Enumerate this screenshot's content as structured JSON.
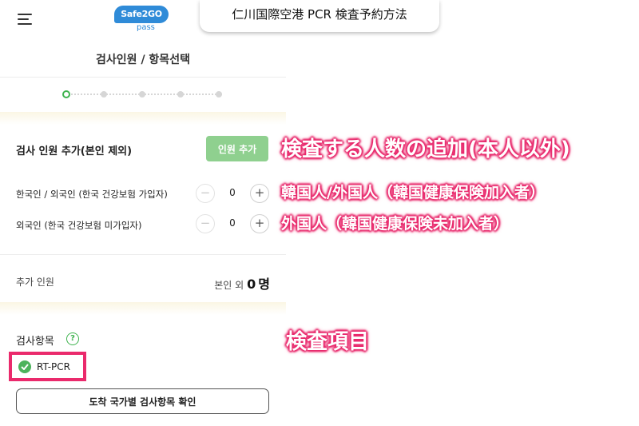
{
  "header": {
    "logo_text": "Safe2GO",
    "logo_sub": "pass",
    "page_title": "검사인원 / 항목선택"
  },
  "caption": "仁川国際空港 PCR 検査予約方法",
  "stepper": {
    "total_steps": 5,
    "current_step": 1
  },
  "add_section": {
    "title": "검사 인원 추가(본인 제외)",
    "add_button_label": "인원 추가",
    "rows": [
      {
        "label": "한국인 / 외국인 (한국 건강보험 가입자)",
        "minus": "−",
        "value": "0",
        "plus": "+"
      },
      {
        "label": "외국인 (한국 건강보험 미가입자)",
        "minus": "−",
        "value": "0",
        "plus": "+"
      }
    ]
  },
  "summary": {
    "label": "추가 인원",
    "prefix": "본인 외",
    "count": "0",
    "unit": "명"
  },
  "test_items": {
    "title": "검사항목",
    "help_icon": "?",
    "selected_item": "RT-PCR",
    "confirm_button_label": "도착 국가별 검사항목 확인"
  },
  "annotations": {
    "add_people": "検査する人数の追加(本人以外)",
    "insured": "韓国人/外国人（韓国健康保険加入者）",
    "uninsured": "外国人（韓国健康保険未加入者）",
    "test_items": "検査項目"
  },
  "colors": {
    "accent_green": "#3fb34f",
    "add_button": "#8fd08f",
    "annotation_pink": "#e8296c",
    "logo_blue": "#2f8bd8"
  }
}
